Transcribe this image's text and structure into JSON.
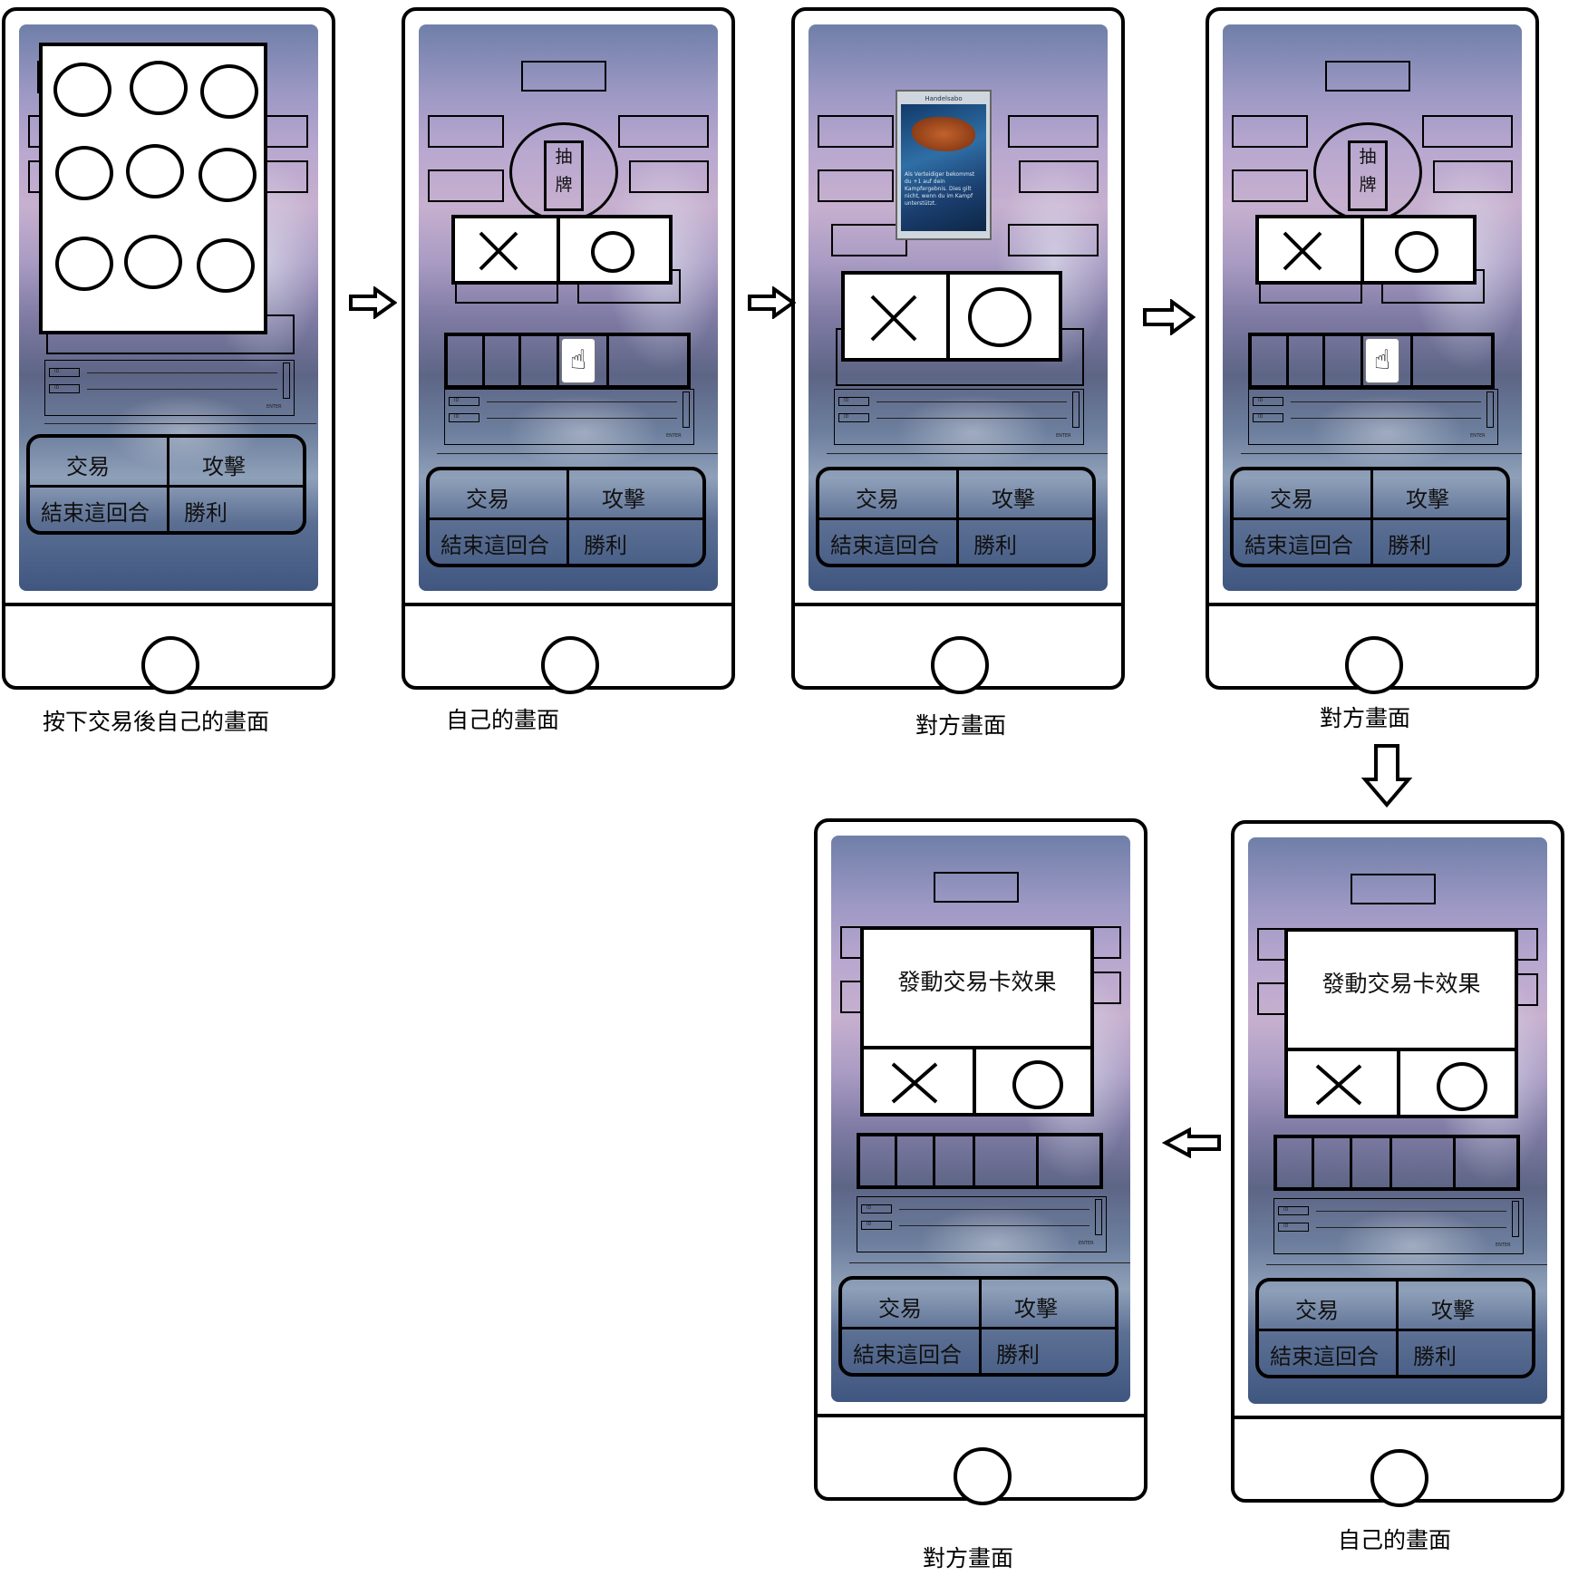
{
  "actions": {
    "trade": "交易",
    "attack": "攻擊",
    "end_turn": "結束這回合",
    "win": "勝利"
  },
  "draw_label": {
    "line1": "抽",
    "line2": "牌"
  },
  "dialog_title": "發動交易卡效果",
  "input_labels": {
    "id": "ID",
    "enter": "ENTER"
  },
  "card_preview": {
    "name": "Handelsabo",
    "text": "Als Verteidiger bekommst du +1 auf dein Kampfergebnis. Dies gilt nicht, wenn du im Kampf unterstützt."
  },
  "captions": {
    "s1": "按下交易後自己的畫面",
    "s2": "自己的畫面",
    "s3": "對方畫面",
    "s4": "對方畫面",
    "s5": "自己的畫面",
    "s6": "對方畫面"
  },
  "colors": {
    "outline": "#000000",
    "dialog_bg": "#ffffff"
  },
  "icons": {
    "confirm": "circle-icon",
    "reject": "x-icon",
    "pointer": "hand-pointer-icon",
    "home": "home-button-icon"
  }
}
